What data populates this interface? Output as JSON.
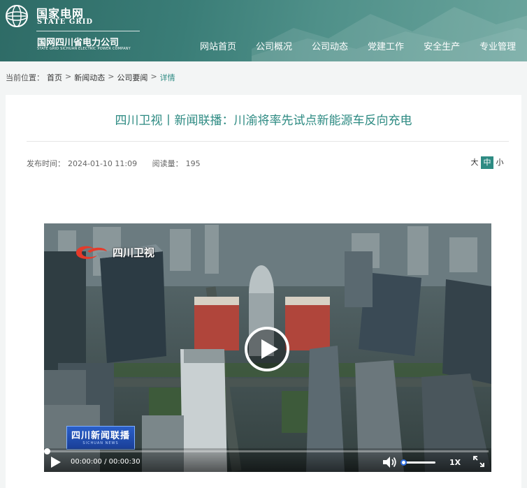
{
  "brand": {
    "name_cn": "国家电网",
    "name_en": "STATE GRID",
    "company_cn": "国网四川省电力公司",
    "company_en": "STATE GRID SICHUAN ELECTRIC POWER COMPANY"
  },
  "nav": {
    "items": [
      "网站首页",
      "公司概况",
      "公司动态",
      "党建工作",
      "安全生产",
      "专业管理"
    ]
  },
  "breadcrumb": {
    "prefix": "当前位置：",
    "items": [
      "首页",
      "新闻动态",
      "公司要闻"
    ],
    "current": "详情",
    "separator": ">"
  },
  "article": {
    "title": "四川卫视丨新闻联播：川渝将率先试点新能源车反向充电",
    "publish_label": "发布时间：",
    "publish_time": "2024-01-10 11:09",
    "reads_label": "阅读量：",
    "reads": "195",
    "font_sizes": [
      "大",
      "中",
      "小"
    ],
    "font_size_active": "中"
  },
  "video": {
    "channel_name": "四川卫视",
    "program_logo": "四川新闻联播",
    "program_logo_en": "SICHUAN NEWS",
    "time": "00:00:00 / 00:00:30",
    "progress": 0,
    "volume": 0,
    "speed": "1X"
  },
  "colors": {
    "accent": "#2e8b83",
    "header": "#3a7d77"
  }
}
